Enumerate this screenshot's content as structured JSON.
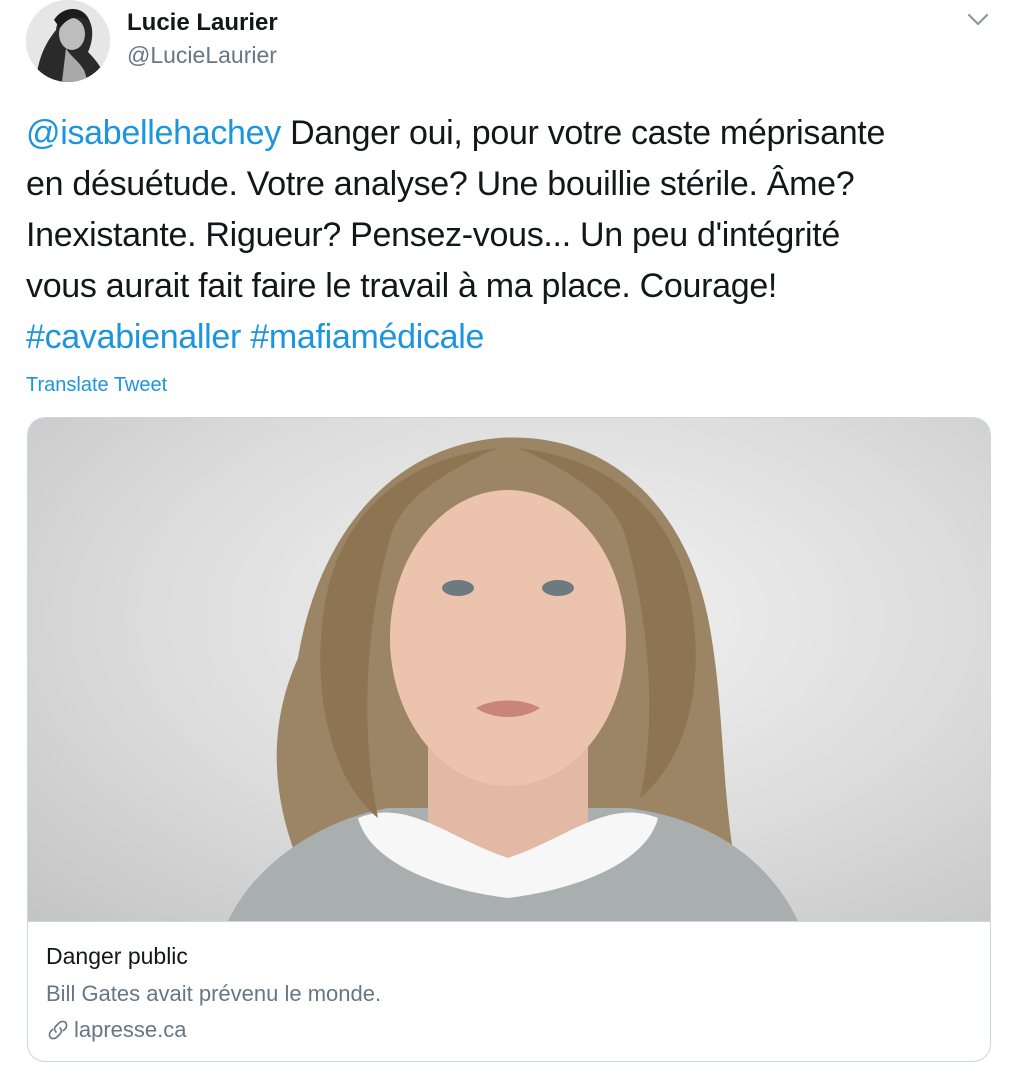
{
  "author": {
    "name": "Lucie Laurier",
    "handle": "@LucieLaurier",
    "avatar_icon": "user-avatar"
  },
  "menu": {
    "icon": "chevron-down-icon"
  },
  "tweet": {
    "line1": {
      "mention": "@isabellehachey",
      "text": " Danger oui, pour votre caste méprisante"
    },
    "line2": "en désuétude. Votre analyse? Une bouillie stérile. Âme?",
    "line3": "Inexistante. Rigueur? Pensez-vous... Un peu d'intégrité",
    "line4": "vous aurait fait faire le travail à ma place. Courage!",
    "hashtags": [
      "#cavabienaller",
      "#mafiamédicale"
    ]
  },
  "translate_label": "Translate Tweet",
  "card": {
    "title": "Danger public",
    "description": "Bill Gates avait prévenu le monde.",
    "domain": "lapresse.ca",
    "domain_icon": "link-icon"
  },
  "colors": {
    "link": "#1b95e0",
    "text": "#14171a",
    "secondary": "#657786",
    "border": "#ccd6dd"
  }
}
